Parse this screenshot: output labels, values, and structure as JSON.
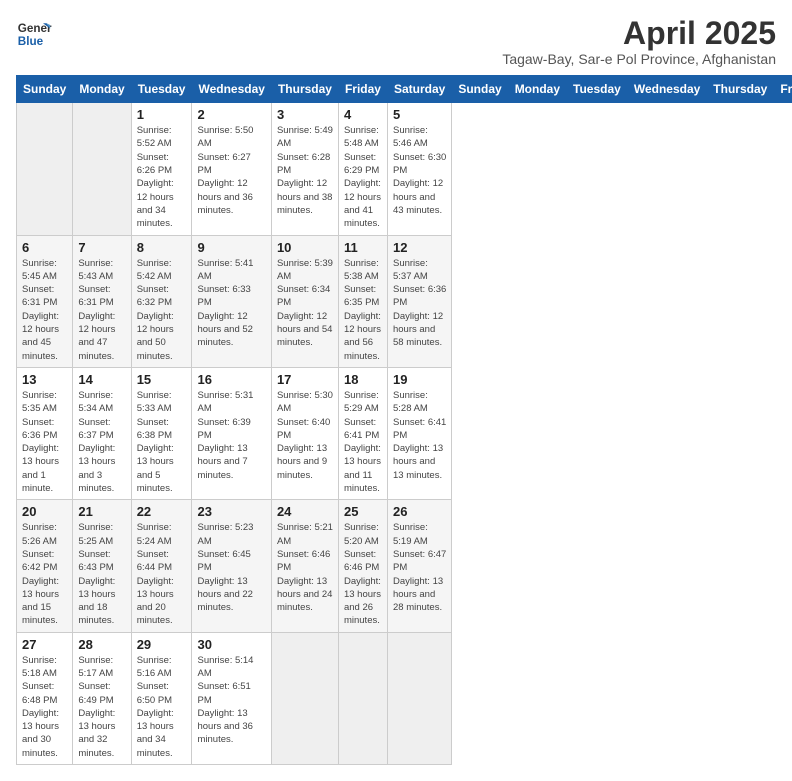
{
  "logo": {
    "line1": "General",
    "line2": "Blue"
  },
  "header": {
    "month": "April 2025",
    "subtitle": "Tagaw-Bay, Sar-e Pol Province, Afghanistan"
  },
  "days_of_week": [
    "Sunday",
    "Monday",
    "Tuesday",
    "Wednesday",
    "Thursday",
    "Friday",
    "Saturday"
  ],
  "weeks": [
    [
      {
        "day": "",
        "info": ""
      },
      {
        "day": "",
        "info": ""
      },
      {
        "day": "1",
        "info": "Sunrise: 5:52 AM\nSunset: 6:26 PM\nDaylight: 12 hours and 34 minutes."
      },
      {
        "day": "2",
        "info": "Sunrise: 5:50 AM\nSunset: 6:27 PM\nDaylight: 12 hours and 36 minutes."
      },
      {
        "day": "3",
        "info": "Sunrise: 5:49 AM\nSunset: 6:28 PM\nDaylight: 12 hours and 38 minutes."
      },
      {
        "day": "4",
        "info": "Sunrise: 5:48 AM\nSunset: 6:29 PM\nDaylight: 12 hours and 41 minutes."
      },
      {
        "day": "5",
        "info": "Sunrise: 5:46 AM\nSunset: 6:30 PM\nDaylight: 12 hours and 43 minutes."
      }
    ],
    [
      {
        "day": "6",
        "info": "Sunrise: 5:45 AM\nSunset: 6:31 PM\nDaylight: 12 hours and 45 minutes."
      },
      {
        "day": "7",
        "info": "Sunrise: 5:43 AM\nSunset: 6:31 PM\nDaylight: 12 hours and 47 minutes."
      },
      {
        "day": "8",
        "info": "Sunrise: 5:42 AM\nSunset: 6:32 PM\nDaylight: 12 hours and 50 minutes."
      },
      {
        "day": "9",
        "info": "Sunrise: 5:41 AM\nSunset: 6:33 PM\nDaylight: 12 hours and 52 minutes."
      },
      {
        "day": "10",
        "info": "Sunrise: 5:39 AM\nSunset: 6:34 PM\nDaylight: 12 hours and 54 minutes."
      },
      {
        "day": "11",
        "info": "Sunrise: 5:38 AM\nSunset: 6:35 PM\nDaylight: 12 hours and 56 minutes."
      },
      {
        "day": "12",
        "info": "Sunrise: 5:37 AM\nSunset: 6:36 PM\nDaylight: 12 hours and 58 minutes."
      }
    ],
    [
      {
        "day": "13",
        "info": "Sunrise: 5:35 AM\nSunset: 6:36 PM\nDaylight: 13 hours and 1 minute."
      },
      {
        "day": "14",
        "info": "Sunrise: 5:34 AM\nSunset: 6:37 PM\nDaylight: 13 hours and 3 minutes."
      },
      {
        "day": "15",
        "info": "Sunrise: 5:33 AM\nSunset: 6:38 PM\nDaylight: 13 hours and 5 minutes."
      },
      {
        "day": "16",
        "info": "Sunrise: 5:31 AM\nSunset: 6:39 PM\nDaylight: 13 hours and 7 minutes."
      },
      {
        "day": "17",
        "info": "Sunrise: 5:30 AM\nSunset: 6:40 PM\nDaylight: 13 hours and 9 minutes."
      },
      {
        "day": "18",
        "info": "Sunrise: 5:29 AM\nSunset: 6:41 PM\nDaylight: 13 hours and 11 minutes."
      },
      {
        "day": "19",
        "info": "Sunrise: 5:28 AM\nSunset: 6:41 PM\nDaylight: 13 hours and 13 minutes."
      }
    ],
    [
      {
        "day": "20",
        "info": "Sunrise: 5:26 AM\nSunset: 6:42 PM\nDaylight: 13 hours and 15 minutes."
      },
      {
        "day": "21",
        "info": "Sunrise: 5:25 AM\nSunset: 6:43 PM\nDaylight: 13 hours and 18 minutes."
      },
      {
        "day": "22",
        "info": "Sunrise: 5:24 AM\nSunset: 6:44 PM\nDaylight: 13 hours and 20 minutes."
      },
      {
        "day": "23",
        "info": "Sunrise: 5:23 AM\nSunset: 6:45 PM\nDaylight: 13 hours and 22 minutes."
      },
      {
        "day": "24",
        "info": "Sunrise: 5:21 AM\nSunset: 6:46 PM\nDaylight: 13 hours and 24 minutes."
      },
      {
        "day": "25",
        "info": "Sunrise: 5:20 AM\nSunset: 6:46 PM\nDaylight: 13 hours and 26 minutes."
      },
      {
        "day": "26",
        "info": "Sunrise: 5:19 AM\nSunset: 6:47 PM\nDaylight: 13 hours and 28 minutes."
      }
    ],
    [
      {
        "day": "27",
        "info": "Sunrise: 5:18 AM\nSunset: 6:48 PM\nDaylight: 13 hours and 30 minutes."
      },
      {
        "day": "28",
        "info": "Sunrise: 5:17 AM\nSunset: 6:49 PM\nDaylight: 13 hours and 32 minutes."
      },
      {
        "day": "29",
        "info": "Sunrise: 5:16 AM\nSunset: 6:50 PM\nDaylight: 13 hours and 34 minutes."
      },
      {
        "day": "30",
        "info": "Sunrise: 5:14 AM\nSunset: 6:51 PM\nDaylight: 13 hours and 36 minutes."
      },
      {
        "day": "",
        "info": ""
      },
      {
        "day": "",
        "info": ""
      },
      {
        "day": "",
        "info": ""
      }
    ]
  ]
}
